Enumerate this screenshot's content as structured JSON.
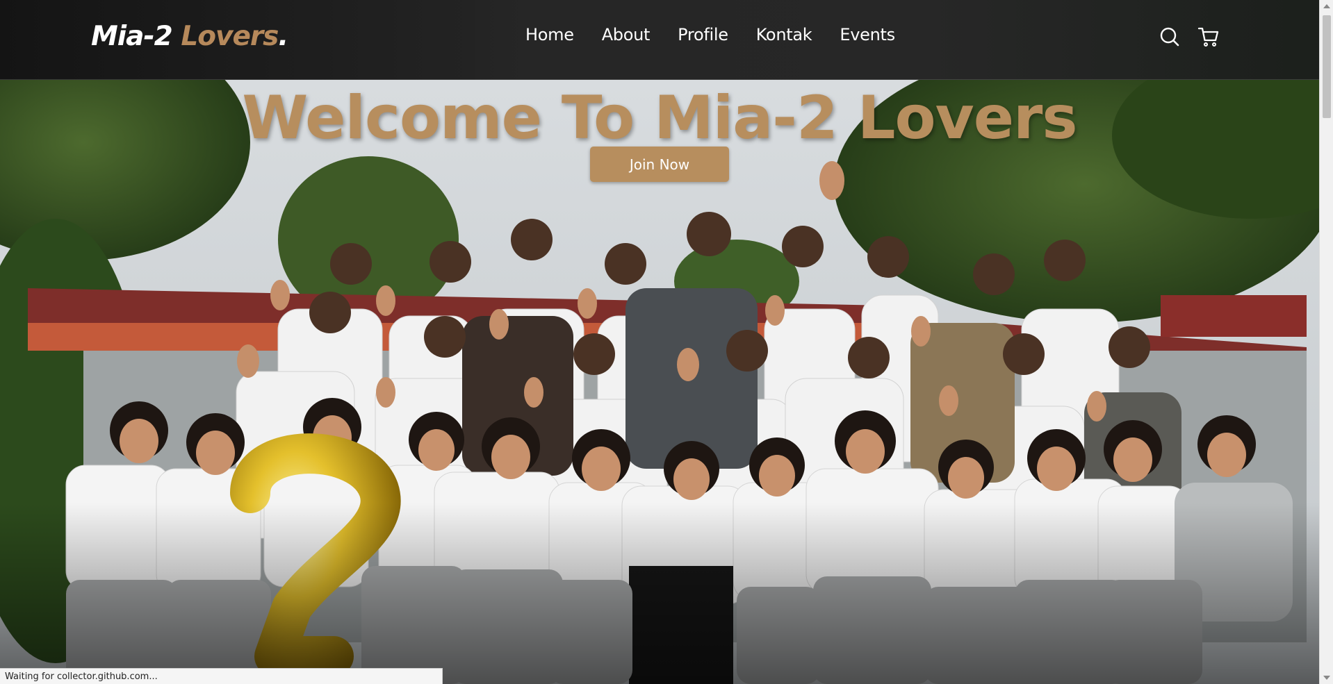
{
  "brand": {
    "logo_part1": "Mia-2 ",
    "logo_part2": "Lovers",
    "logo_dot": ".",
    "accent_color": "#b78e5e"
  },
  "nav": {
    "links": [
      {
        "label": "Home"
      },
      {
        "label": "About"
      },
      {
        "label": "Profile"
      },
      {
        "label": "Kontak"
      },
      {
        "label": "Events"
      }
    ],
    "icons": [
      "search-icon",
      "cart-icon"
    ]
  },
  "hero": {
    "title": "Welcome To Mia-2 Lovers",
    "button_label": "Join Now",
    "image": "class-group-photo"
  },
  "browser": {
    "status_text": "Waiting for collector.github.com..."
  }
}
